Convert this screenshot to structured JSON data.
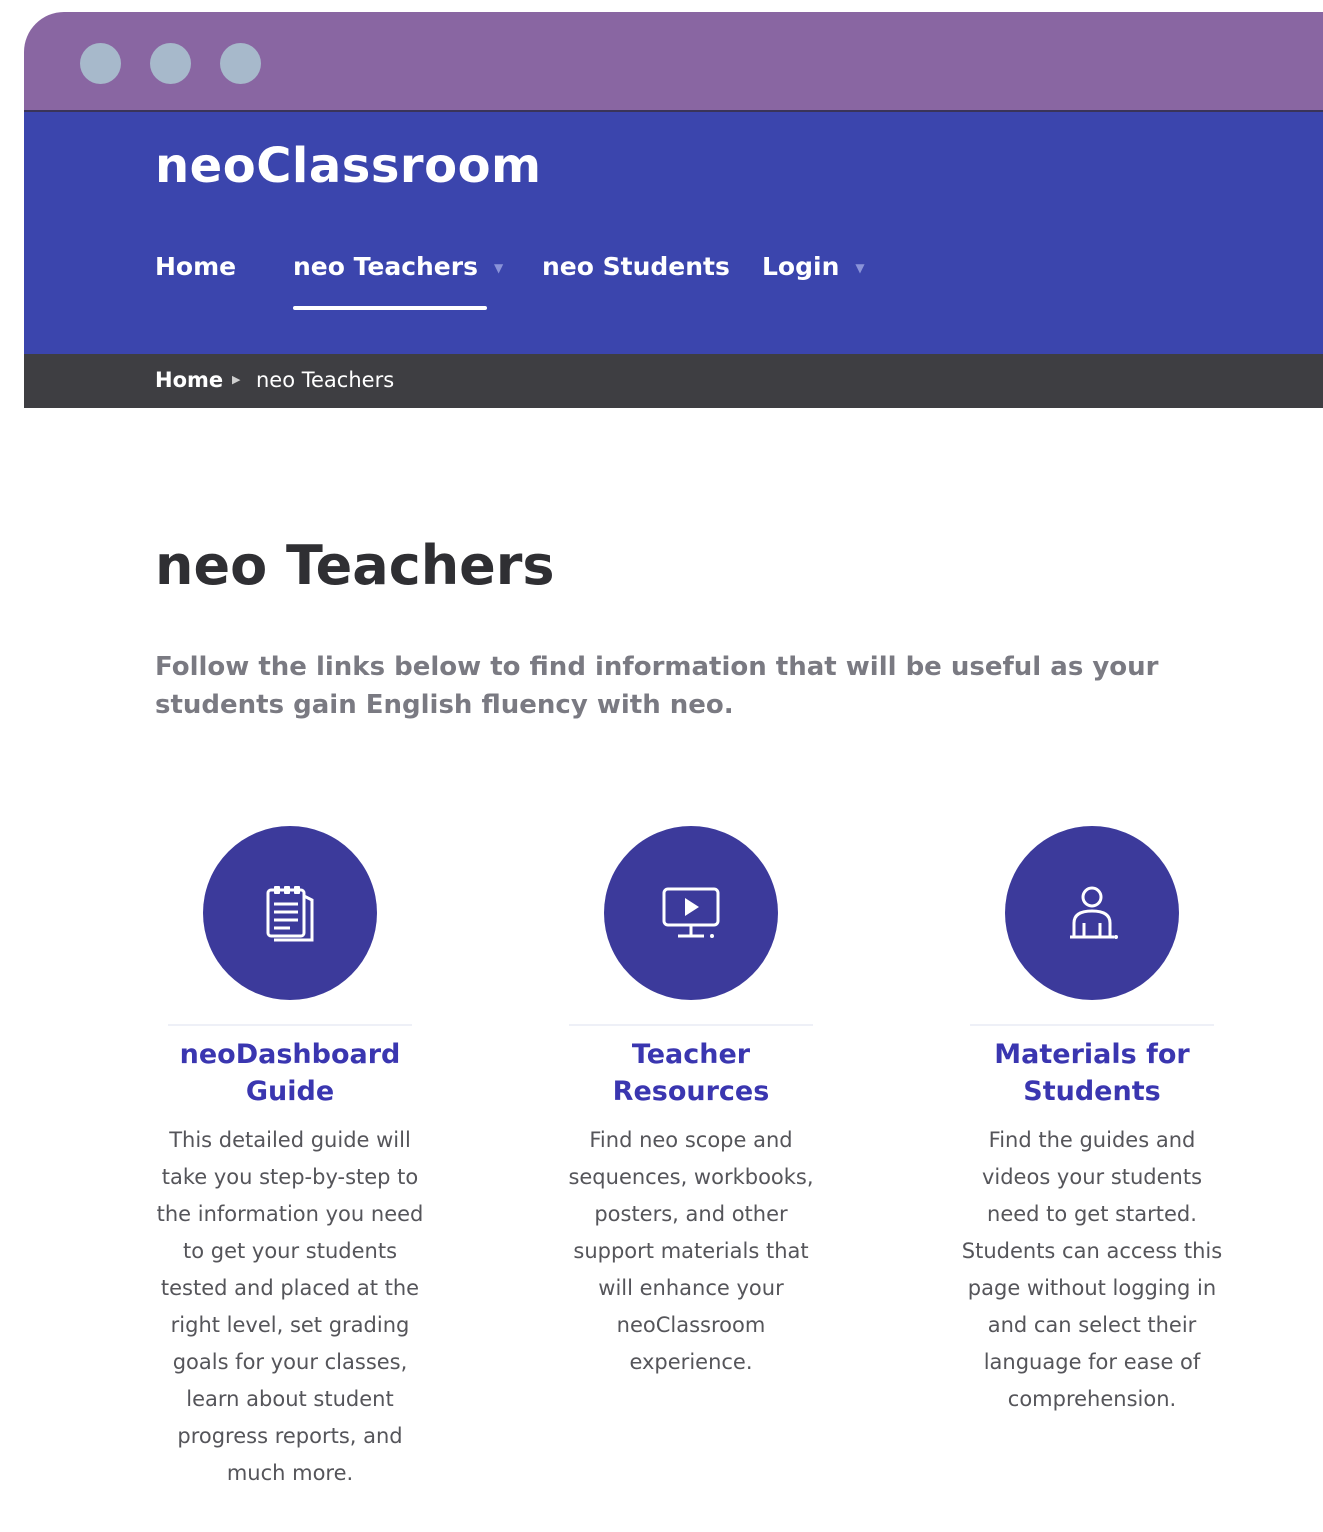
{
  "window": {
    "controls": [
      "close",
      "minimize",
      "maximize"
    ]
  },
  "header": {
    "brand": "neoClassroom",
    "nav": [
      {
        "label": "Home",
        "active": false,
        "dropdown": false
      },
      {
        "label": "neo Teachers",
        "active": true,
        "dropdown": true
      },
      {
        "label": "neo Students",
        "active": false,
        "dropdown": false
      },
      {
        "label": "Login",
        "active": false,
        "dropdown": true
      }
    ]
  },
  "breadcrumb": {
    "home": "Home",
    "current": "neo Teachers"
  },
  "main": {
    "title": "neo Teachers",
    "intro": "Follow the links below to find information that will be useful as your students gain English fluency with neo.",
    "cards": [
      {
        "icon": "guide-document-icon",
        "title": "neoDashboard Guide",
        "description": "This detailed guide will take you step-by-step to the information you need to get your students tested and placed at the right level, set grading goals for your classes, learn about student progress reports, and much more."
      },
      {
        "icon": "monitor-play-icon",
        "title": "Teacher Resources",
        "description": "Find neo scope and sequences, workbooks, posters, and other support materials that will enhance your neoClassroom experience."
      },
      {
        "icon": "student-user-icon",
        "title": "Materials for Students",
        "description": "Find the guides and videos your students need to get started. Students can access this page without logging in and can select their language for ease of comprehension."
      }
    ]
  },
  "colors": {
    "titlebar": "#8966a2",
    "header": "#3b45ad",
    "breadcrumb": "#3e3e42",
    "card_circle": "#3c3a9b",
    "card_title": "#3a36b0"
  }
}
